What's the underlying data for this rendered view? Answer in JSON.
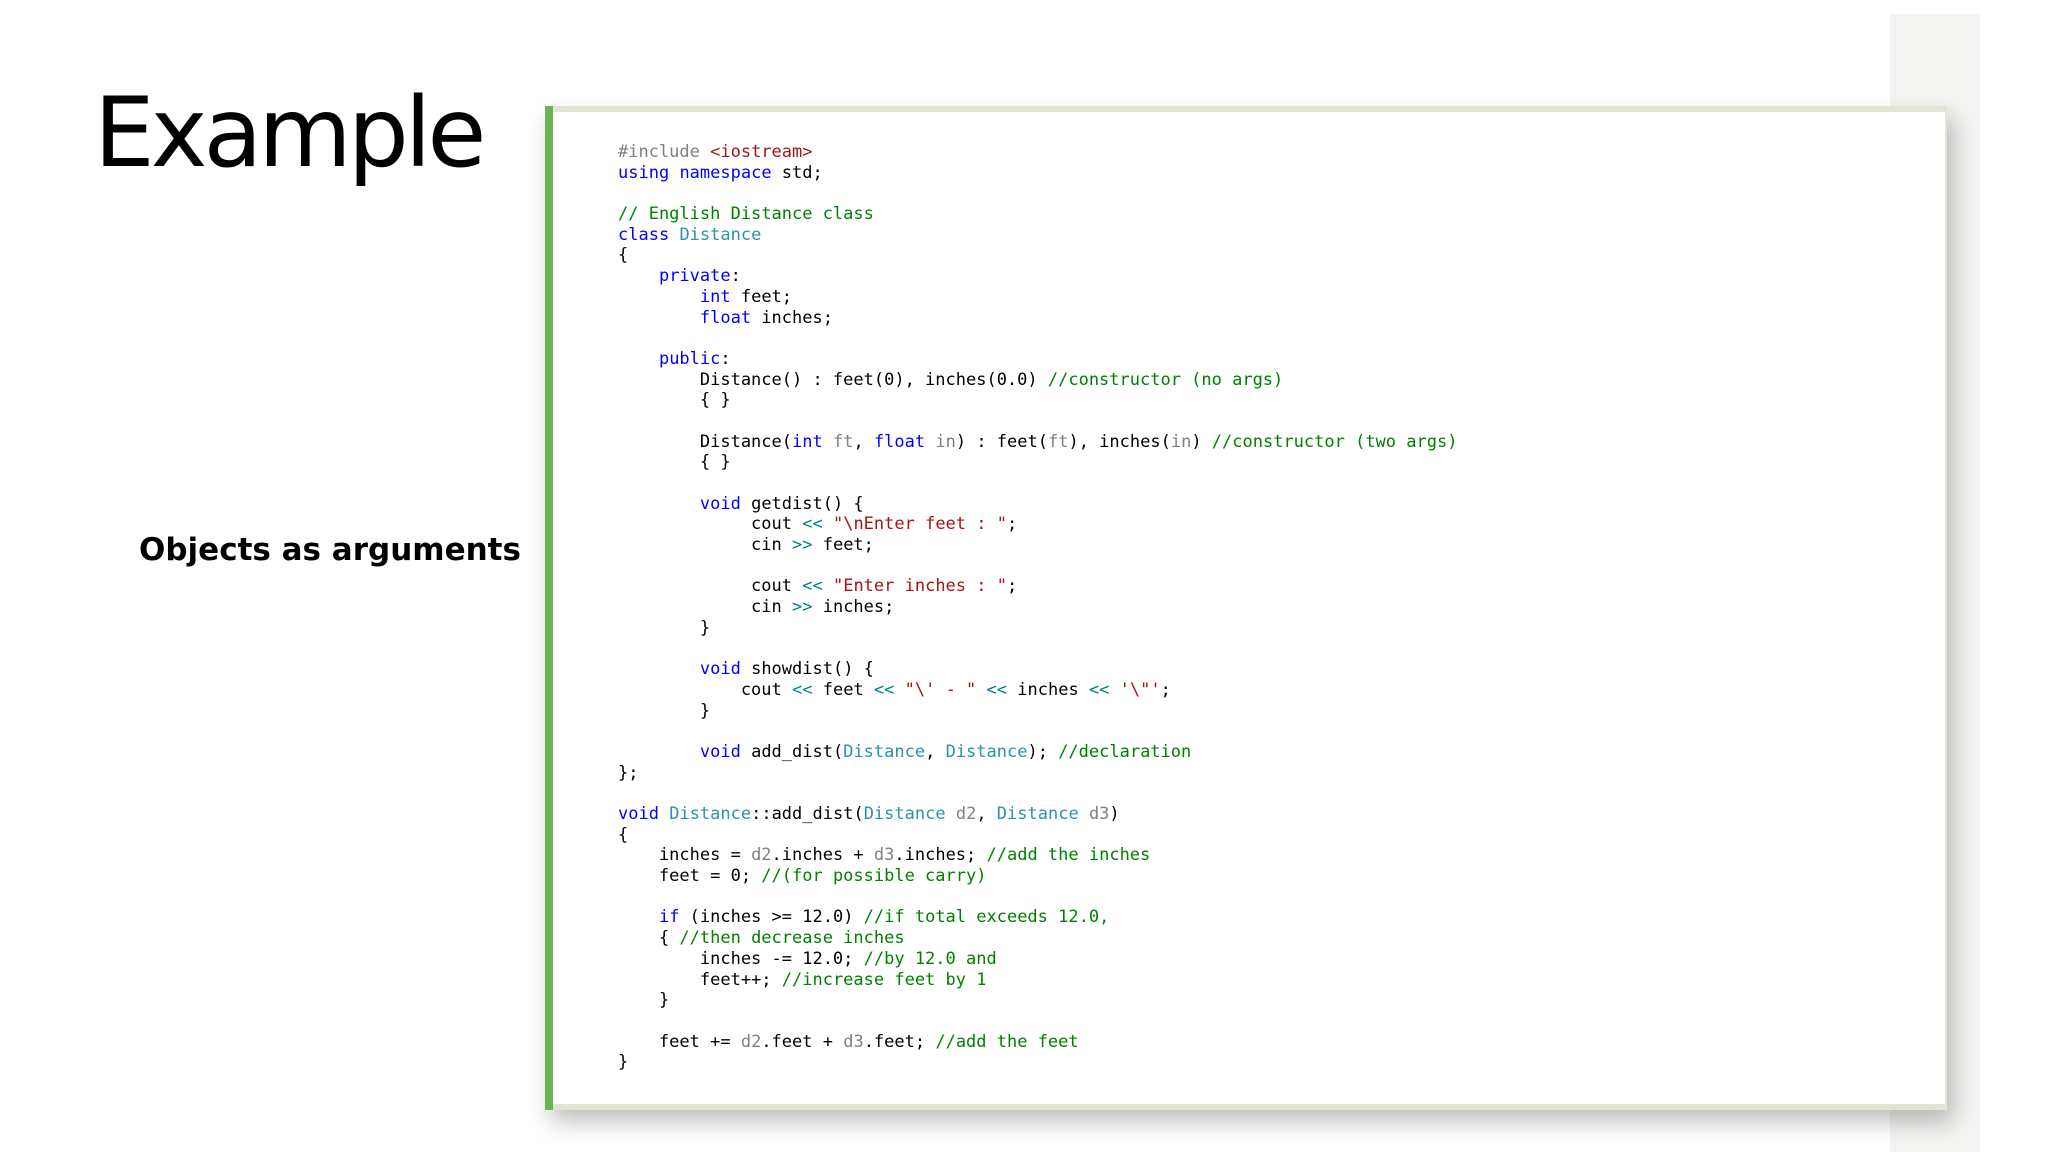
{
  "slide": {
    "title": "Example",
    "subtitle": "Objects as arguments",
    "accent_color": "#6ab552"
  },
  "code": {
    "language": "C++",
    "lines": [
      [
        {
          "t": "#include ",
          "k": "pre"
        },
        {
          "t": "<iostream>",
          "k": "str"
        }
      ],
      [
        {
          "t": "using",
          "k": "kw"
        },
        {
          "t": " "
        },
        {
          "t": "namespace",
          "k": "kw"
        },
        {
          "t": " std;"
        }
      ],
      [],
      [
        {
          "t": "// English Distance class",
          "k": "cm"
        }
      ],
      [
        {
          "t": "class",
          "k": "kw"
        },
        {
          "t": " "
        },
        {
          "t": "Distance",
          "k": "type"
        }
      ],
      [
        {
          "t": "{"
        }
      ],
      [
        {
          "t": "    "
        },
        {
          "t": "private",
          "k": "kw"
        },
        {
          "t": ":"
        }
      ],
      [
        {
          "t": "        "
        },
        {
          "t": "int",
          "k": "kw"
        },
        {
          "t": " feet;"
        }
      ],
      [
        {
          "t": "        "
        },
        {
          "t": "float",
          "k": "kw"
        },
        {
          "t": " inches;"
        }
      ],
      [],
      [
        {
          "t": "    "
        },
        {
          "t": "public",
          "k": "kw"
        },
        {
          "t": ":"
        }
      ],
      [
        {
          "t": "        Distance() : feet(0), inches(0.0) "
        },
        {
          "t": "//constructor (no args)",
          "k": "cm"
        }
      ],
      [
        {
          "t": "        { }"
        }
      ],
      [],
      [
        {
          "t": "        Distance("
        },
        {
          "t": "int",
          "k": "kw"
        },
        {
          "t": " "
        },
        {
          "t": "ft",
          "k": "param"
        },
        {
          "t": ", "
        },
        {
          "t": "float",
          "k": "kw"
        },
        {
          "t": " "
        },
        {
          "t": "in",
          "k": "param"
        },
        {
          "t": ") : feet("
        },
        {
          "t": "ft",
          "k": "param"
        },
        {
          "t": "), inches("
        },
        {
          "t": "in",
          "k": "param"
        },
        {
          "t": ") "
        },
        {
          "t": "//constructor (two args)",
          "k": "cm"
        }
      ],
      [
        {
          "t": "        { }"
        }
      ],
      [],
      [
        {
          "t": "        "
        },
        {
          "t": "void",
          "k": "kw"
        },
        {
          "t": " getdist() {"
        }
      ],
      [
        {
          "t": "             cout "
        },
        {
          "t": "<<",
          "k": "op"
        },
        {
          "t": " "
        },
        {
          "t": "\"\\nEnter feet : \"",
          "k": "str"
        },
        {
          "t": ";"
        }
      ],
      [
        {
          "t": "             cin "
        },
        {
          "t": ">>",
          "k": "op"
        },
        {
          "t": " feet;"
        }
      ],
      [],
      [
        {
          "t": "             cout "
        },
        {
          "t": "<<",
          "k": "op"
        },
        {
          "t": " "
        },
        {
          "t": "\"Enter inches : \"",
          "k": "str"
        },
        {
          "t": ";"
        }
      ],
      [
        {
          "t": "             cin "
        },
        {
          "t": ">>",
          "k": "op"
        },
        {
          "t": " inches;"
        }
      ],
      [
        {
          "t": "        }"
        }
      ],
      [],
      [
        {
          "t": "        "
        },
        {
          "t": "void",
          "k": "kw"
        },
        {
          "t": " showdist() {"
        }
      ],
      [
        {
          "t": "            cout "
        },
        {
          "t": "<<",
          "k": "op"
        },
        {
          "t": " feet "
        },
        {
          "t": "<<",
          "k": "op"
        },
        {
          "t": " "
        },
        {
          "t": "\"\\' - \"",
          "k": "str"
        },
        {
          "t": " "
        },
        {
          "t": "<<",
          "k": "op"
        },
        {
          "t": " inches "
        },
        {
          "t": "<<",
          "k": "op"
        },
        {
          "t": " "
        },
        {
          "t": "'\\\"'",
          "k": "str"
        },
        {
          "t": ";"
        }
      ],
      [
        {
          "t": "        }"
        }
      ],
      [],
      [
        {
          "t": "        "
        },
        {
          "t": "void",
          "k": "kw"
        },
        {
          "t": " add_dist("
        },
        {
          "t": "Distance",
          "k": "type"
        },
        {
          "t": ", "
        },
        {
          "t": "Distance",
          "k": "type"
        },
        {
          "t": "); "
        },
        {
          "t": "//declaration",
          "k": "cm"
        }
      ],
      [
        {
          "t": "};"
        }
      ],
      [],
      [
        {
          "t": "void",
          "k": "kw"
        },
        {
          "t": " "
        },
        {
          "t": "Distance",
          "k": "type"
        },
        {
          "t": "::add_dist("
        },
        {
          "t": "Distance",
          "k": "type"
        },
        {
          "t": " "
        },
        {
          "t": "d2",
          "k": "param"
        },
        {
          "t": ", "
        },
        {
          "t": "Distance",
          "k": "type"
        },
        {
          "t": " "
        },
        {
          "t": "d3",
          "k": "param"
        },
        {
          "t": ")"
        }
      ],
      [
        {
          "t": "{"
        }
      ],
      [
        {
          "t": "    inches = "
        },
        {
          "t": "d2",
          "k": "param"
        },
        {
          "t": ".inches + "
        },
        {
          "t": "d3",
          "k": "param"
        },
        {
          "t": ".inches; "
        },
        {
          "t": "//add the inches",
          "k": "cm"
        }
      ],
      [
        {
          "t": "    feet = 0; "
        },
        {
          "t": "//(for possible carry)",
          "k": "cm"
        }
      ],
      [],
      [
        {
          "t": "    "
        },
        {
          "t": "if",
          "k": "kw"
        },
        {
          "t": " (inches >= 12.0) "
        },
        {
          "t": "//if total exceeds 12.0,",
          "k": "cm"
        }
      ],
      [
        {
          "t": "    { "
        },
        {
          "t": "//then decrease inches",
          "k": "cm"
        }
      ],
      [
        {
          "t": "        inches -= 12.0; "
        },
        {
          "t": "//by 12.0 and",
          "k": "cm"
        }
      ],
      [
        {
          "t": "        feet++; "
        },
        {
          "t": "//increase feet by 1",
          "k": "cm"
        }
      ],
      [
        {
          "t": "    }"
        }
      ],
      [],
      [
        {
          "t": "    feet += "
        },
        {
          "t": "d2",
          "k": "param"
        },
        {
          "t": ".feet + "
        },
        {
          "t": "d3",
          "k": "param"
        },
        {
          "t": ".feet; "
        },
        {
          "t": "//add the feet",
          "k": "cm"
        }
      ],
      [
        {
          "t": "}"
        }
      ]
    ]
  }
}
